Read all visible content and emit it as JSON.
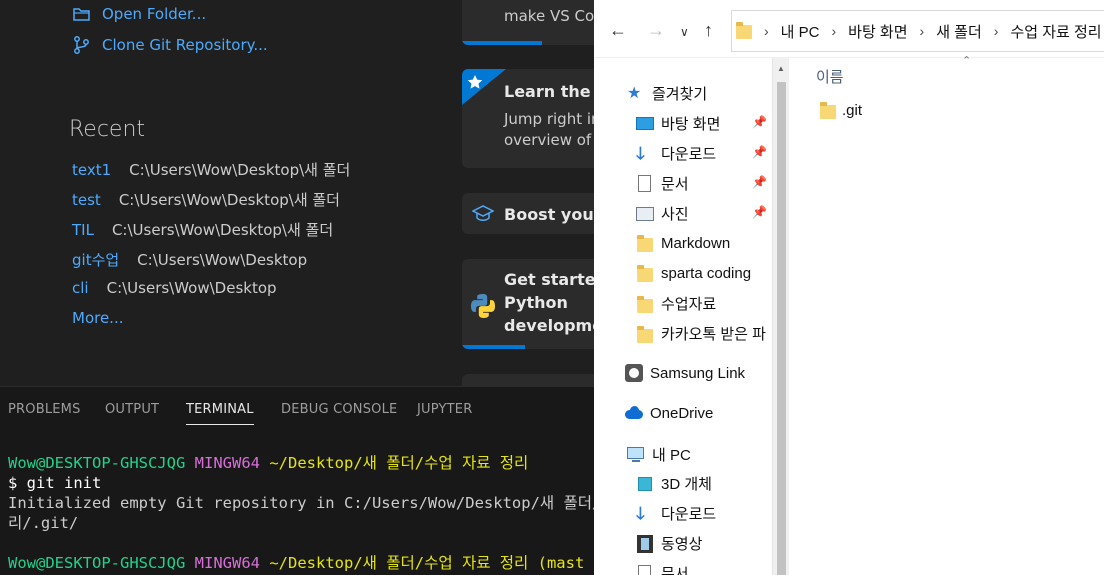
{
  "vscode": {
    "start": {
      "open_folder": "Open Folder...",
      "clone_repo": "Clone Git Repository..."
    },
    "recent": {
      "title": "Recent",
      "items": [
        {
          "name": "text1",
          "path": "C:\\Users\\Wow\\Desktop\\새 폴더"
        },
        {
          "name": "test",
          "path": "C:\\Users\\Wow\\Desktop\\새 폴더"
        },
        {
          "name": "TIL",
          "path": "C:\\Users\\Wow\\Desktop\\새 폴더"
        },
        {
          "name": "git수업",
          "path": "C:\\Users\\Wow\\Desktop"
        },
        {
          "name": "cli",
          "path": "C:\\Users\\Wow\\Desktop"
        }
      ],
      "more": "More..."
    },
    "walkthroughs": [
      {
        "title": "",
        "desc": "make VS Coc",
        "progress": 0.57
      },
      {
        "title": "Learn the F",
        "desc1": "Jump right in",
        "desc2": "overview of t",
        "progress": 0.0
      },
      {
        "title": "Boost your",
        "progress": 0.0
      },
      {
        "title1": "Get started",
        "title2": "Python",
        "title3": "developmen",
        "progress": 0.45
      }
    ],
    "panel": {
      "tabs": [
        "PROBLEMS",
        "OUTPUT",
        "TERMINAL",
        "DEBUG CONSOLE",
        "JUPYTER"
      ],
      "active_tab": "TERMINAL",
      "terminal": {
        "prompt_user": "Wow@DESKTOP-GHSCJQG",
        "prompt_sys": "MINGW64",
        "prompt_path": "~/Desktop/새 폴더/수업 자료 정리",
        "command": "$ git init",
        "output1": "Initialized empty Git repository in C:/Users/Wow/Desktop/새 폴더/",
        "output2": "리/.git/",
        "prompt2_path": "~/Desktop/새 폴더/수업 자료 정리 (mast",
        "cursor": "$"
      }
    }
  },
  "explorer": {
    "breadcrumb": [
      "내 PC",
      "바탕 화면",
      "새 폴더",
      "수업 자료 정리"
    ],
    "sidebar": {
      "quick_access": "즐겨찾기",
      "items": [
        {
          "label": "바탕 화면",
          "pinned": true
        },
        {
          "label": "다운로드",
          "pinned": true
        },
        {
          "label": "문서",
          "pinned": true
        },
        {
          "label": "사진",
          "pinned": true
        },
        {
          "label": "Markdown"
        },
        {
          "label": "sparta coding"
        },
        {
          "label": "수업자료"
        },
        {
          "label": "카카오톡 받은 파"
        }
      ],
      "samsung_link": "Samsung Link",
      "onedrive": "OneDrive",
      "this_pc": "내 PC",
      "pc_items": [
        "3D 개체",
        "다운로드",
        "동영상",
        "문서"
      ]
    },
    "content": {
      "column_name": "이름",
      "files": [
        ".git"
      ]
    },
    "colors": {
      "link": "#4daafc",
      "accent": "#0078d4",
      "folder": "#f8d775"
    }
  }
}
